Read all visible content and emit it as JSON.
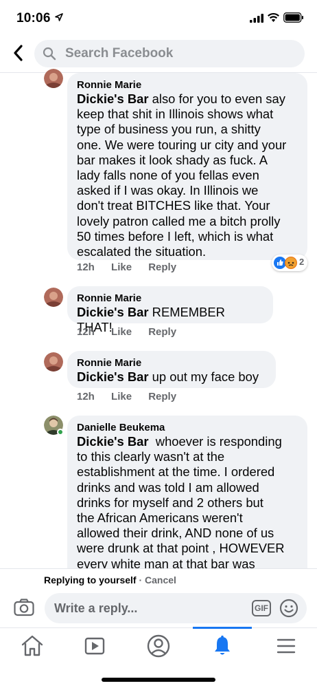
{
  "status_bar": {
    "time": "10:06"
  },
  "search": {
    "placeholder": "Search Facebook"
  },
  "comments": [
    {
      "author": "Ronnie Marie",
      "mention": "Dickie's Bar",
      "text_lines": [
        " also for you to even say",
        "keep that shit in Illinois shows what",
        "type of business you run, a shitty",
        "one. We were touring ur city and your",
        "bar makes it look shady as fuck. A",
        "lady falls none of you fellas even",
        "asked if I was okay. In Illinois we",
        "don't treat BITCHES like that. Your",
        "lovely patron called me a bitch prolly",
        "50 times before I left, which is what",
        "escalated the situation."
      ],
      "time": "12h",
      "like": "Like",
      "reply": "Reply",
      "reaction_count": "2"
    },
    {
      "author": "Ronnie Marie",
      "mention": "Dickie's Bar",
      "text_lines": [
        " REMEMBER THAT!"
      ],
      "time": "12h",
      "like": "Like",
      "reply": "Reply"
    },
    {
      "author": "Ronnie Marie",
      "mention": "Dickie's Bar",
      "text_lines": [
        " up out my face boy"
      ],
      "time": "12h",
      "like": "Like",
      "reply": "Reply"
    },
    {
      "author": "Danielle Beukema",
      "mention": "Dickie's Bar",
      "text_lines": [
        "  whoever is responding",
        "to this clearly wasn't at the",
        "establishment at the time. I ordered",
        "drinks and was told I am allowed",
        "drinks for myself and 2 others but",
        "the African Americans weren't",
        "allowed their drink, AND none of us",
        "were drunk at that point , HOWEVER",
        "every white man at that bar was"
      ]
    }
  ],
  "reply_bar": {
    "replying_label": "Replying to yourself",
    "separator": " · ",
    "cancel_label": "Cancel",
    "input_placeholder": "Write a reply...",
    "gif_label": "GIF"
  },
  "tabs": [
    "home",
    "watch",
    "profile",
    "notifications",
    "menu"
  ],
  "colors": {
    "accent": "#1877f2",
    "bubble": "#f0f2f5",
    "meta": "#65676b"
  }
}
